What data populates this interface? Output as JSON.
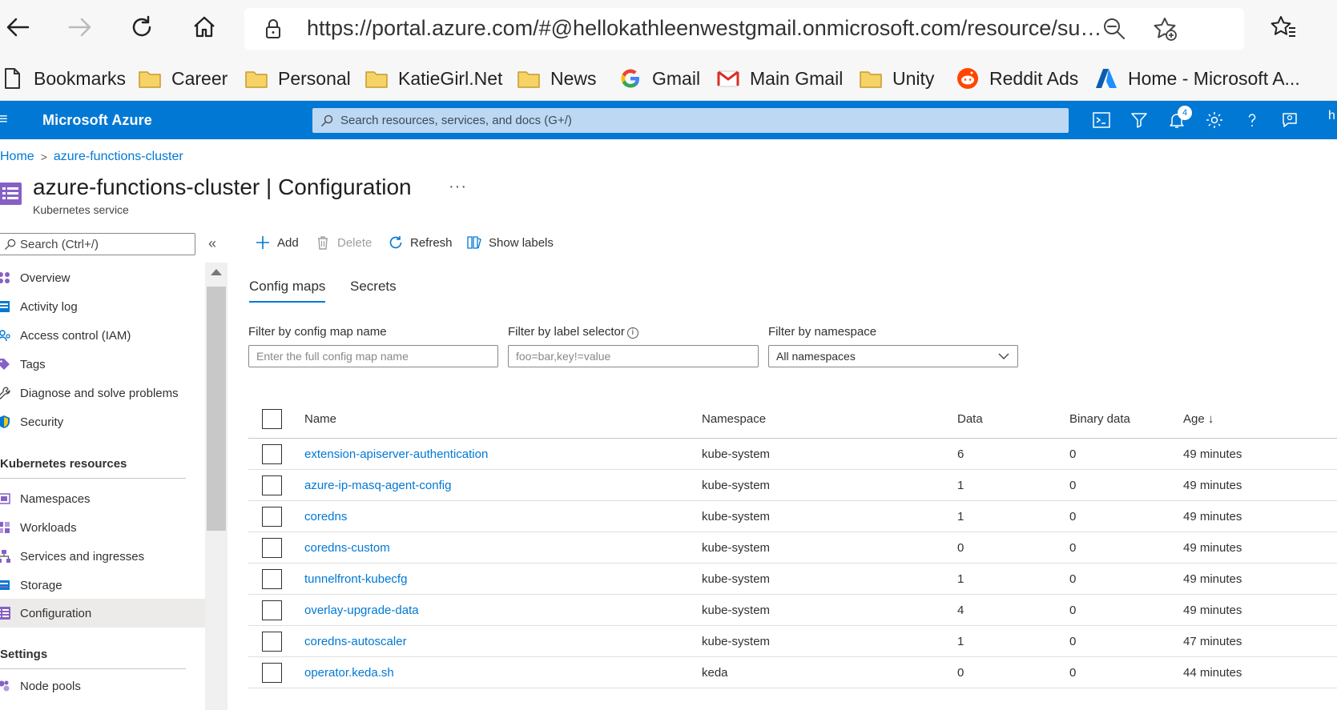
{
  "browser": {
    "url": "https://portal.azure.com/#@hellokathleenwestgmail.onmicrosoft.com/resource/subscription...",
    "bookmarks": [
      {
        "label": "Bookmarks",
        "icon": "page-icon"
      },
      {
        "label": "Career",
        "icon": "folder-icon"
      },
      {
        "label": "Personal",
        "icon": "folder-icon"
      },
      {
        "label": "KatieGirl.Net",
        "icon": "folder-icon"
      },
      {
        "label": "News",
        "icon": "folder-icon"
      },
      {
        "label": "Gmail",
        "icon": "google-icon"
      },
      {
        "label": "Main Gmail",
        "icon": "gmail-icon"
      },
      {
        "label": "Unity",
        "icon": "folder-icon"
      },
      {
        "label": "Reddit Ads",
        "icon": "reddit-icon"
      },
      {
        "label": "Home - Microsoft A...",
        "icon": "azure-icon"
      }
    ]
  },
  "header": {
    "brand": "Microsoft Azure",
    "search_placeholder": "Search resources, services, and docs (G+/)",
    "notification_count": "4",
    "user_initial": "h",
    "accent": "#0078d4"
  },
  "breadcrumb": {
    "home": "Home",
    "resource": "azure-functions-cluster"
  },
  "page": {
    "title_resource": "azure-functions-cluster",
    "title_separator": " | ",
    "title_section": "Configuration",
    "subtitle": "Kubernetes service",
    "more": "···"
  },
  "nav": {
    "search_placeholder": "Search (Ctrl+/)",
    "collapse": "«",
    "items_top": [
      {
        "label": "Overview",
        "icon": "overview-icon"
      },
      {
        "label": "Activity log",
        "icon": "activity-log-icon"
      },
      {
        "label": "Access control (IAM)",
        "icon": "iam-icon"
      },
      {
        "label": "Tags",
        "icon": "tag-icon"
      },
      {
        "label": "Diagnose and solve problems",
        "icon": "wrench-icon"
      },
      {
        "label": "Security",
        "icon": "shield-icon"
      }
    ],
    "section_kubernetes": "Kubernetes resources",
    "items_k8s": [
      {
        "label": "Namespaces",
        "icon": "namespaces-icon"
      },
      {
        "label": "Workloads",
        "icon": "workloads-icon"
      },
      {
        "label": "Services and ingresses",
        "icon": "services-icon"
      },
      {
        "label": "Storage",
        "icon": "storage-icon"
      },
      {
        "label": "Configuration",
        "icon": "configuration-icon"
      }
    ],
    "section_settings": "Settings",
    "items_settings": [
      {
        "label": "Node pools",
        "icon": "node-pools-icon"
      }
    ]
  },
  "toolbar": {
    "add": "Add",
    "delete": "Delete",
    "refresh": "Refresh",
    "show_labels": "Show labels"
  },
  "tabs": {
    "config_maps": "Config maps",
    "secrets": "Secrets"
  },
  "filters": {
    "name_label": "Filter by config map name",
    "name_placeholder": "Enter the full config map name",
    "label_label": "Filter by label selector",
    "label_placeholder": "foo=bar,key!=value",
    "namespace_label": "Filter by namespace",
    "namespace_value": "All namespaces"
  },
  "table": {
    "columns": {
      "name": "Name",
      "namespace": "Namespace",
      "data": "Data",
      "binary": "Binary data",
      "age": "Age ↓"
    },
    "rows": [
      {
        "name": "extension-apiserver-authentication",
        "namespace": "kube-system",
        "data": "6",
        "binary": "0",
        "age": "49 minutes"
      },
      {
        "name": "azure-ip-masq-agent-config",
        "namespace": "kube-system",
        "data": "1",
        "binary": "0",
        "age": "49 minutes"
      },
      {
        "name": "coredns",
        "namespace": "kube-system",
        "data": "1",
        "binary": "0",
        "age": "49 minutes"
      },
      {
        "name": "coredns-custom",
        "namespace": "kube-system",
        "data": "0",
        "binary": "0",
        "age": "49 minutes"
      },
      {
        "name": "tunnelfront-kubecfg",
        "namespace": "kube-system",
        "data": "1",
        "binary": "0",
        "age": "49 minutes"
      },
      {
        "name": "overlay-upgrade-data",
        "namespace": "kube-system",
        "data": "4",
        "binary": "0",
        "age": "49 minutes"
      },
      {
        "name": "coredns-autoscaler",
        "namespace": "kube-system",
        "data": "1",
        "binary": "0",
        "age": "47 minutes"
      },
      {
        "name": "operator.keda.sh",
        "namespace": "keda",
        "data": "0",
        "binary": "0",
        "age": "44 minutes"
      }
    ]
  }
}
